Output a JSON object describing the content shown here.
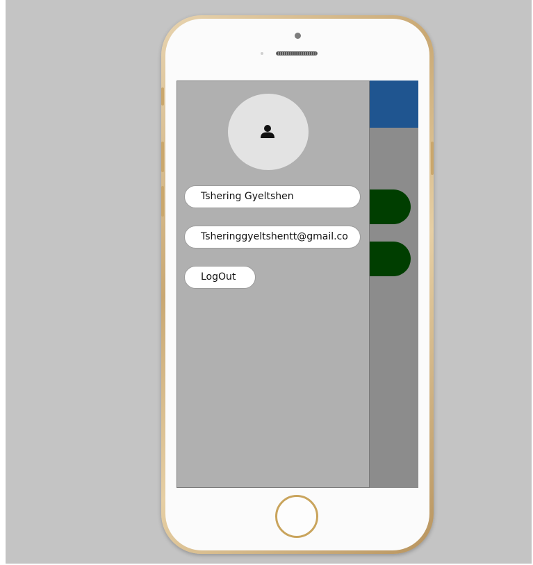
{
  "drawer": {
    "avatar_icon": "user-icon",
    "user_name": "Tshering Gyeltshen",
    "user_email": "Tsheringgyeltshentt@gmail.co",
    "logout_label": "LogOut"
  },
  "colors": {
    "header_blue": "#1f5590",
    "button_green": "#003e00",
    "drawer_bg": "#b0b0b0",
    "screen_bg": "#8c8c8c"
  }
}
